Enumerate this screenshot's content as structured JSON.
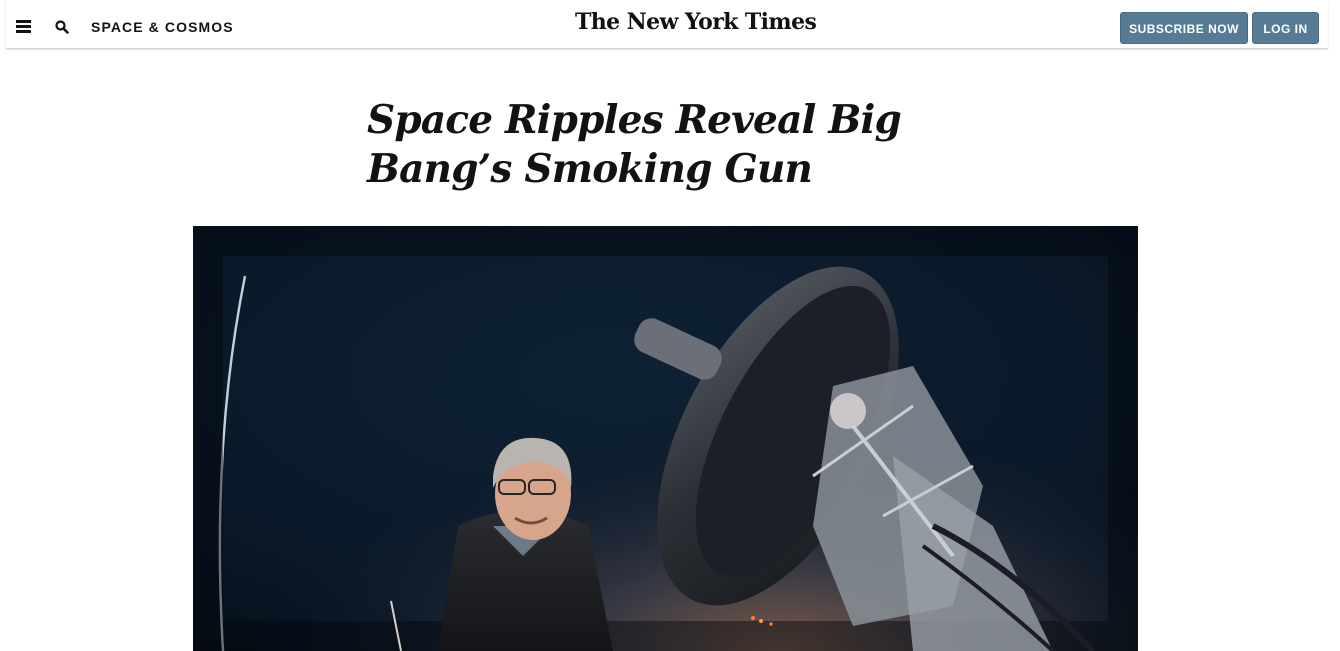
{
  "header": {
    "section_label": "SPACE & COSMOS",
    "logo_text": "The New York Times",
    "subscribe_label": "SUBSCRIBE NOW",
    "login_label": "LOG IN",
    "icons": [
      "menu-icon",
      "search-icon"
    ]
  },
  "article": {
    "headline_line1": "Space Ripples Reveal Big",
    "headline_line2": "Bang’s Smoking Gun"
  },
  "colors": {
    "button_bg": "#567b95",
    "text": "#121212",
    "photo_sky": "#0c1a2a"
  }
}
